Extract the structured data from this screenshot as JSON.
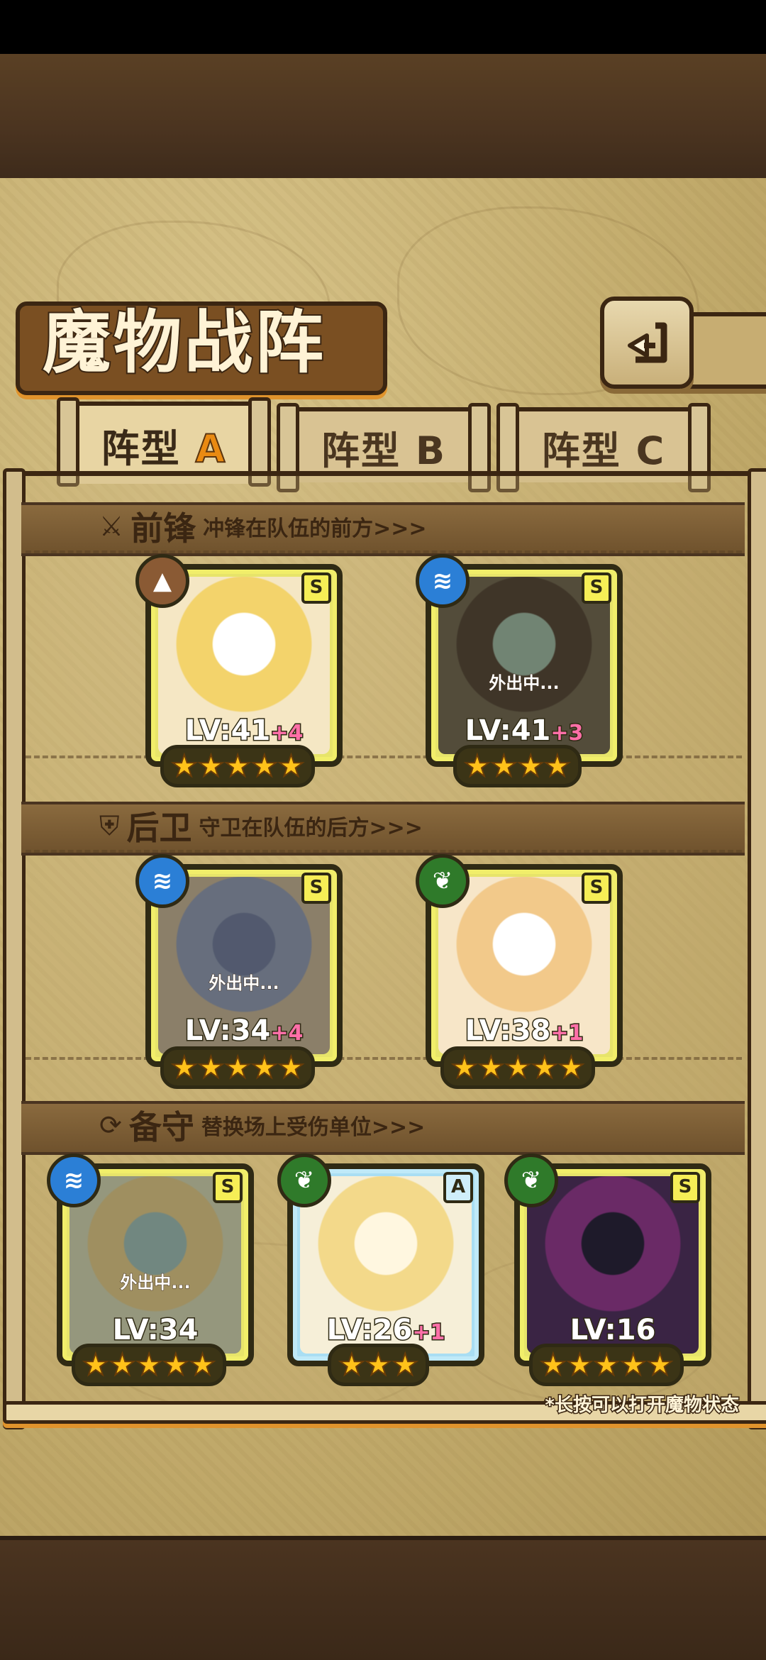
{
  "title": "魔物战阵",
  "back_icon": "back-arrow-icon",
  "tabs": [
    {
      "prefix": "阵型",
      "letter": "A",
      "active": true
    },
    {
      "prefix": "阵型",
      "letter": "B",
      "active": false
    },
    {
      "prefix": "阵型",
      "letter": "C",
      "active": false
    }
  ],
  "sections": {
    "front": {
      "icon": "sword-icon",
      "name": "前锋",
      "desc": "冲锋在队伍的前方>>>"
    },
    "back": {
      "icon": "shield-icon",
      "name": "后卫",
      "desc": "守卫在队伍的后方>>>"
    },
    "reserve": {
      "icon": "swap-icon",
      "name": "备守",
      "desc": "替换场上受伤单位>>>"
    }
  },
  "away_text": "外出中...",
  "units": [
    {
      "element": "earth",
      "rank": "S",
      "level": "LV:41",
      "bonus": "+4",
      "stars": 5,
      "away": false
    },
    {
      "element": "water",
      "rank": "S",
      "level": "LV:41",
      "bonus": "+3",
      "stars": 4,
      "away": true
    },
    {
      "element": "water",
      "rank": "S",
      "level": "LV:34",
      "bonus": "+4",
      "stars": 5,
      "away": true
    },
    {
      "element": "nature",
      "rank": "S",
      "level": "LV:38",
      "bonus": "+1",
      "stars": 5,
      "away": false
    },
    {
      "element": "water",
      "rank": "S",
      "level": "LV:34",
      "bonus": "",
      "stars": 5,
      "away": true
    },
    {
      "element": "nature",
      "rank": "A",
      "level": "LV:26",
      "bonus": "+1",
      "stars": 3,
      "away": false
    },
    {
      "element": "nature",
      "rank": "S",
      "level": "LV:16",
      "bonus": "",
      "stars": 5,
      "away": false
    }
  ],
  "footnote": "*长按可以打开魔物状态",
  "colors": {
    "accent": "#e98a12",
    "wood": "#3b2612",
    "card_s": "#e7e46a",
    "card_a": "#a9def3",
    "bonus": "#ff6fa8"
  }
}
